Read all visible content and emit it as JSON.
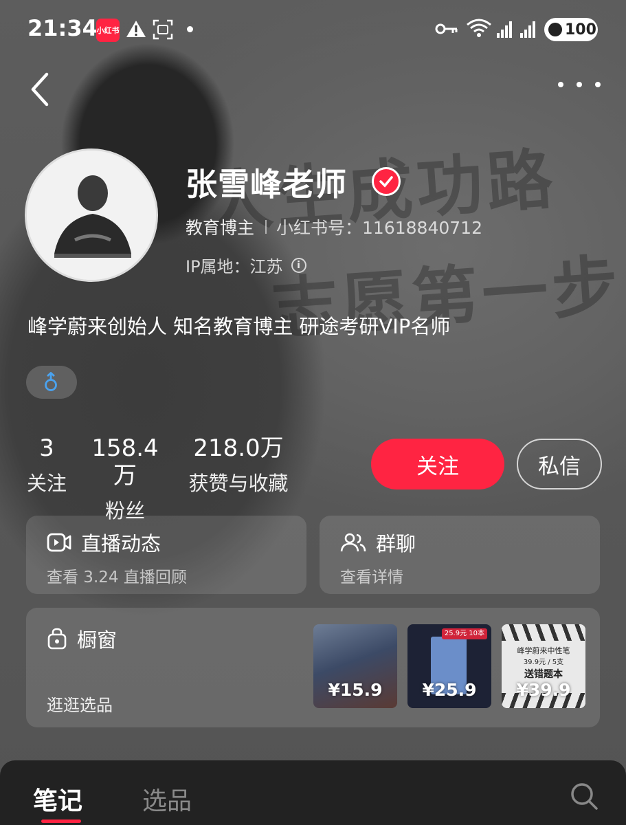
{
  "status_bar": {
    "time": "21:34",
    "app_badge": "小红书",
    "battery": "100"
  },
  "background": {
    "line1": "人生成功路",
    "line2": "志愿第一步"
  },
  "profile": {
    "name": "张雪峰老师",
    "role": "教育博主",
    "red_id": "小红书号：11618840712",
    "ip": "IP属地：江苏",
    "bio": "峰学蔚来创始人 知名教育博主 研途考研VIP名师",
    "gender_symbol": "♂"
  },
  "stats": [
    {
      "value": "3",
      "label": "关注"
    },
    {
      "value": "158.4万",
      "label": "粉丝"
    },
    {
      "value": "218.0万",
      "label": "获赞与收藏"
    }
  ],
  "actions": {
    "follow": "关注",
    "message": "私信"
  },
  "cards": {
    "live": {
      "title": "直播动态",
      "subtitle": "查看 3.24 直播回顾"
    },
    "group": {
      "title": "群聊",
      "subtitle": "查看详情"
    },
    "shop": {
      "title": "橱窗",
      "subtitle": "逛逛选品"
    }
  },
  "products": [
    {
      "price": "¥15.9"
    },
    {
      "price": "¥25.9",
      "tag": "25.9元 10本"
    },
    {
      "price": "¥39.9",
      "line1": "峰学蔚来中性笔",
      "line2": "39.9元 / 5支",
      "line3": "送错题本"
    }
  ],
  "tabs": {
    "active": "笔记",
    "inactive": "选品"
  },
  "colors": {
    "accent": "#ff2442",
    "background": "#5b5b5b",
    "tab_bar": "#222222"
  },
  "icons": {
    "back": "chevron-left-icon",
    "more": "more-dots-icon",
    "verified": "verified-check-icon",
    "info": "info-icon",
    "live": "video-live-icon",
    "group": "group-people-icon",
    "shop": "shopping-bag-icon",
    "search": "search-icon"
  }
}
